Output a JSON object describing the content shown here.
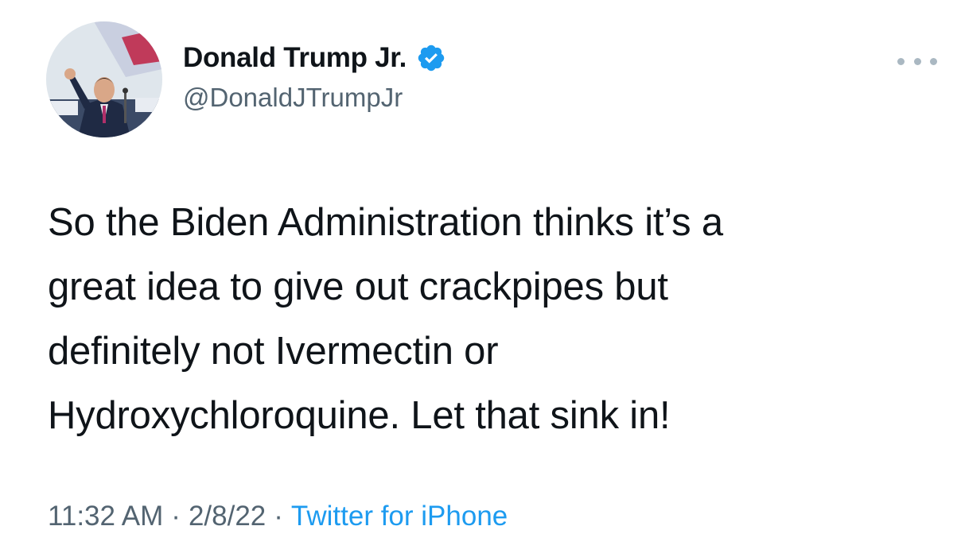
{
  "author": {
    "display_name": "Donald Trump Jr.",
    "handle": "@DonaldJTrumpJr",
    "verified": true,
    "verified_color": "#1d9bf0"
  },
  "tweet": {
    "text": "So the Biden Administration thinks it’s a\ngreat idea to give out crackpipes but\ndefinitely not Ivermectin or\nHydroxychloroquine. Let that sink in!",
    "time": "11:32 AM",
    "date": "2/8/22",
    "separator": "·",
    "source": "Twitter for iPhone"
  },
  "icons": {
    "more": "more-dots-icon",
    "verified": "verified-badge-icon"
  },
  "colors": {
    "text": "#0f1419",
    "secondary": "#536471",
    "link": "#1d9bf0"
  }
}
